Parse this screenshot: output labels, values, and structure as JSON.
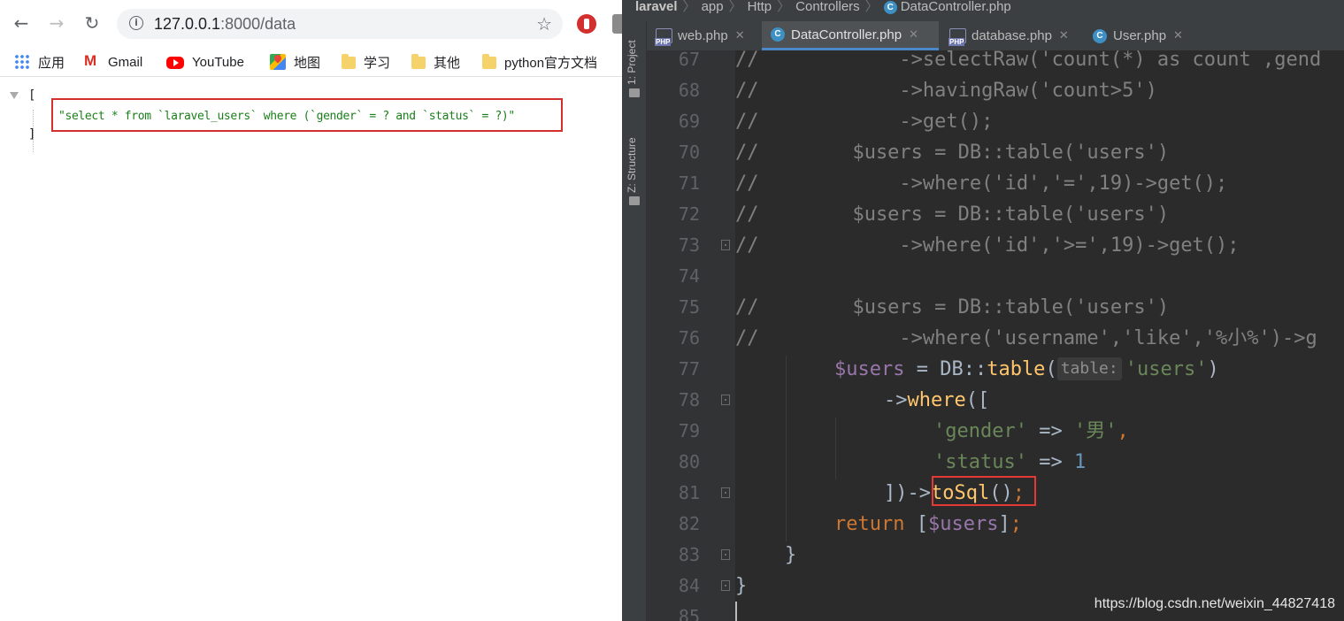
{
  "browser": {
    "url_host": "127.0.0.1",
    "url_path": ":8000/data",
    "bookmarks": [
      "应用",
      "Gmail",
      "YouTube",
      "地图",
      "学习",
      "其他",
      "python官方文档"
    ],
    "json_open_bracket": "[",
    "json_close_bracket": "]",
    "json_string": "\"select * from `laravel_users` where (`gender` = ? and `status` = ?)\""
  },
  "ide": {
    "breadcrumbs": [
      "laravel",
      "app",
      "Http",
      "Controllers",
      "DataController.php"
    ],
    "side_tabs": [
      "1: Project",
      "Z: Structure"
    ],
    "tabs": [
      "web.php",
      "DataController.php",
      "database.php",
      "User.php"
    ],
    "active_tab": "DataController.php",
    "line_numbers": [
      "67",
      "68",
      "69",
      "70",
      "71",
      "72",
      "73",
      "74",
      "75",
      "76",
      "77",
      "78",
      "79",
      "80",
      "81",
      "82",
      "83",
      "84",
      "85"
    ],
    "code_lines": [
      "//            ->selectRaw('count(*) as count ,gend",
      "//            ->havingRaw('count>5')",
      "//            ->get();",
      "//        $users = DB::table('users')",
      "//            ->where('id','=',19)->get();",
      "//        $users = DB::table('users')",
      "//            ->where('id','>=',19)->get();",
      "",
      "//        $users = DB::table('users')",
      "//            ->where('username','like','%小%')->g"
    ],
    "param_hint": "table:",
    "code_tokens": {
      "users_var": "$users",
      "assign": " = DB::",
      "table_fn": "table",
      "open_paren": "(",
      "users_str": "'users'",
      "close_paren": ")",
      "arrow": "->",
      "where_fn": "where",
      "where_open": "([",
      "gender_key": "'gender'",
      "fat_arrow": " => ",
      "gender_val": "'男'",
      "comma": ",",
      "status_key": "'status'",
      "status_val": "1",
      "close_arr": "])->",
      "tosql_fn": "toSql",
      "tosql_parens": "()",
      "semicolon": ";",
      "return_kw": "return",
      "return_open": " [",
      "return_var": "$users",
      "return_close": "]",
      "brace": "}"
    },
    "watermark": "https://blog.csdn.net/weixin_44827418"
  }
}
